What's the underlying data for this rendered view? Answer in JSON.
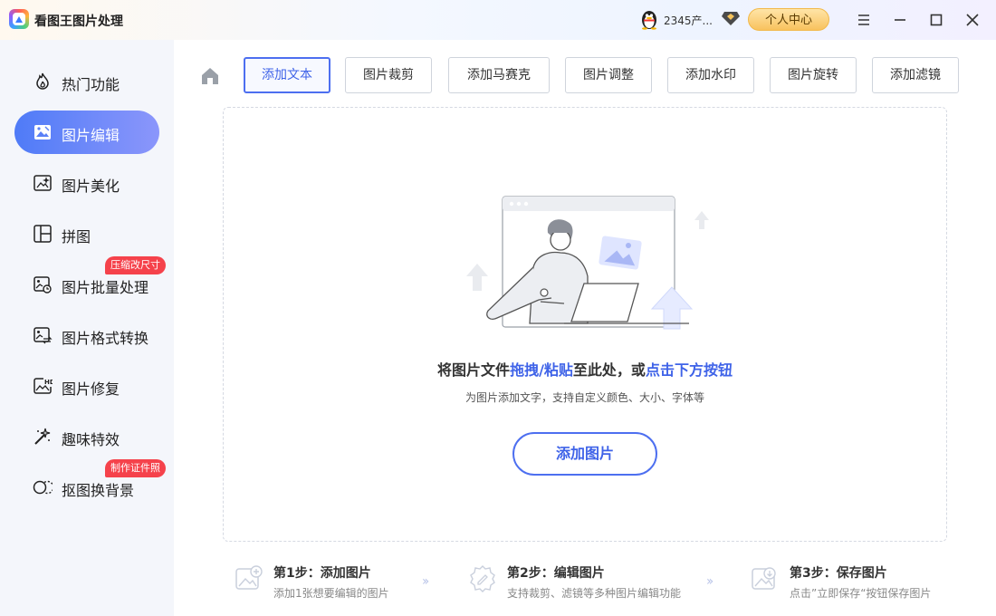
{
  "app": {
    "title": "看图王图片处理"
  },
  "header": {
    "user_name": "2345产...",
    "profile_label": "个人中心"
  },
  "sidebar": {
    "items": [
      {
        "label": "热门功能",
        "icon": "flame-icon"
      },
      {
        "label": "图片编辑",
        "icon": "image-edit-icon",
        "active": true
      },
      {
        "label": "图片美化",
        "icon": "sparkle-image-icon"
      },
      {
        "label": "拼图",
        "icon": "collage-icon"
      },
      {
        "label": "图片批量处理",
        "icon": "batch-image-icon",
        "badge": "压缩改尺寸"
      },
      {
        "label": "图片格式转换",
        "icon": "convert-image-icon"
      },
      {
        "label": "图片修复",
        "icon": "hd-image-icon"
      },
      {
        "label": "趣味特效",
        "icon": "magic-wand-icon"
      },
      {
        "label": "抠图换背景",
        "icon": "cutout-icon",
        "badge": "制作证件照"
      }
    ]
  },
  "toolbar": {
    "tabs": [
      {
        "label": "添加文本",
        "active": true
      },
      {
        "label": "图片裁剪"
      },
      {
        "label": "添加马赛克"
      },
      {
        "label": "图片调整"
      },
      {
        "label": "添加水印"
      },
      {
        "label": "图片旋转"
      },
      {
        "label": "添加滤镜"
      }
    ]
  },
  "dropzone": {
    "title_part1": "将图片文件",
    "title_part2": "拖拽/粘贴",
    "title_part3": "至此处，或",
    "title_part4": "点击下方按钮",
    "subtitle": "为图片添加文字，支持自定义颜色、大小、字体等",
    "add_button": "添加图片"
  },
  "steps": [
    {
      "title": "第1步：添加图片",
      "desc": "添加1张想要编辑的图片"
    },
    {
      "title": "第2步：编辑图片",
      "desc": "支持裁剪、滤镜等多种图片编辑功能"
    },
    {
      "title": "第3步：保存图片",
      "desc": "点击”立即保存“按钮保存图片"
    }
  ],
  "colors": {
    "accent": "#4d6ff0",
    "badge": "#f5424b",
    "profile_gold": "#f8c25e"
  }
}
